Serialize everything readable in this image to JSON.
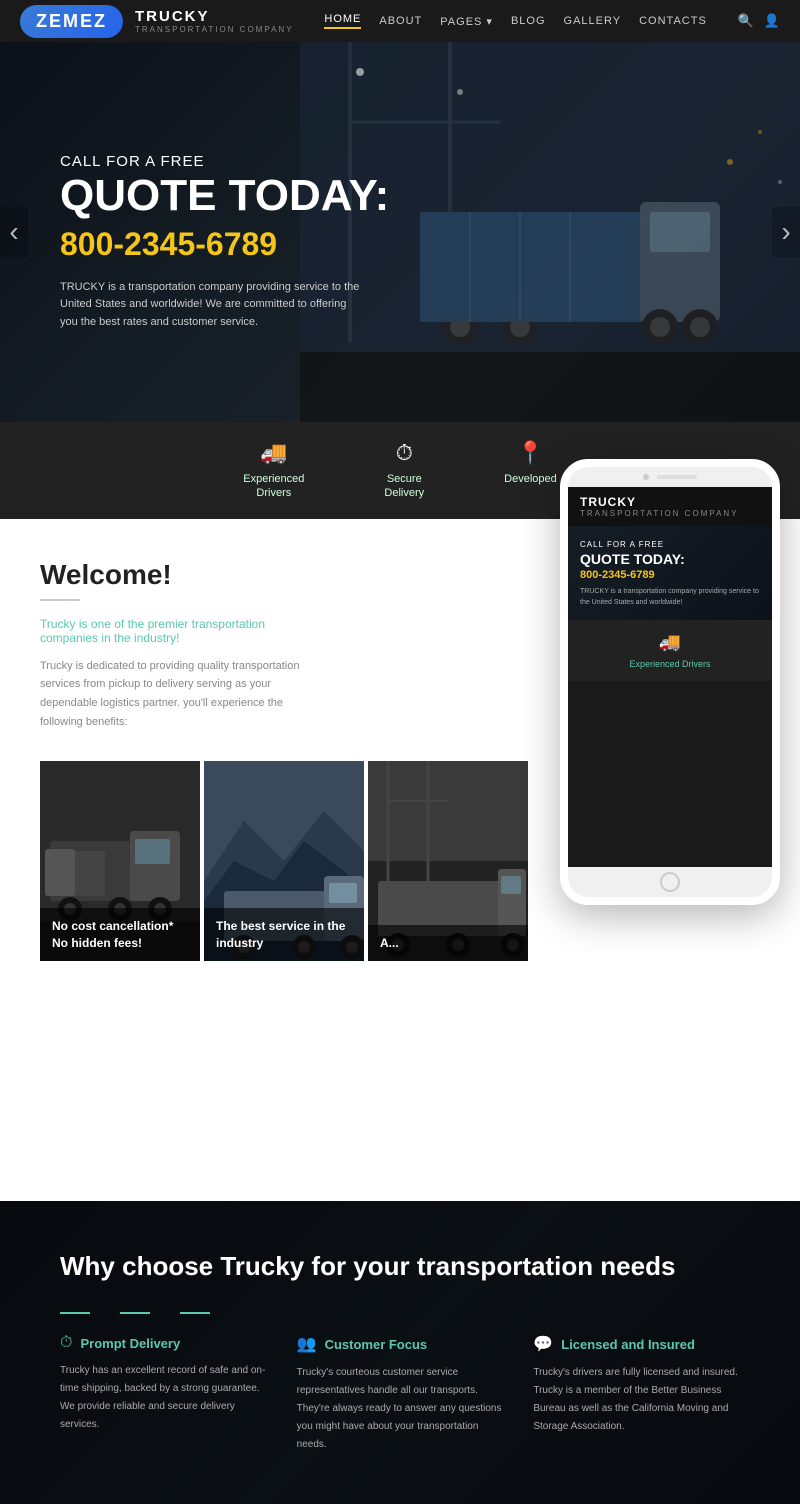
{
  "nav": {
    "brand": "TRUCKY",
    "brand_sub": "TRANSPORTATION COMPANY",
    "links": [
      "HOME",
      "ABOUT",
      "PAGES",
      "BLOG",
      "GALLERY",
      "CONTACTS"
    ],
    "active": "HOME"
  },
  "hero": {
    "call_label": "CALL FOR A FREE",
    "quote_label": "QUOTE TODAY:",
    "phone": "800-2345-6789",
    "description": "TRUCKY is a transportation company providing service to the United States and worldwide! We are committed to offering you the best rates and customer service."
  },
  "features": [
    {
      "icon": "🚚",
      "label": "Experienced\nDrivers"
    },
    {
      "icon": "⏱",
      "label": "Secure\nDelivery"
    },
    {
      "icon": "📍",
      "label": "Developed"
    }
  ],
  "welcome": {
    "title": "Welcome!",
    "subtitle": "Trucky is one of the premier transportation companies in the industry!",
    "description": "Trucky is dedicated to providing quality transportation services from pickup to delivery serving as your dependable logistics partner. you'll experience the following benefits:"
  },
  "gallery": [
    {
      "label": "No cost cancellation*\nNo hidden fees!"
    },
    {
      "label": "The best service in the industry"
    },
    {
      "label": "A..."
    }
  ],
  "phone_mockup": {
    "brand": "TRUCKY",
    "brand_sub": "TRANSPORTATION COMPANY",
    "call_label": "CALL FOR A FREE",
    "quote_label": "QUOTE TODAY:",
    "phone": "800-2345-6789",
    "description": "TRUCKY is a transportation company providing service to the United States and worldwide!",
    "feature_label": "Experienced Drivers"
  },
  "why": {
    "title": "Why choose Trucky for your transportation needs",
    "items": [
      {
        "icon": "⏱",
        "title": "Prompt Delivery",
        "description": "Trucky has an excellent record of safe and on-time shipping, backed by a strong guarantee. We provide reliable and secure delivery services."
      },
      {
        "icon": "👥",
        "title": "Customer Focus",
        "description": "Trucky's courteous customer service representatives handle all our transports. They're always ready to answer any questions you might have about your transportation needs."
      },
      {
        "icon": "💬",
        "title": "Licensed and Insured",
        "description": "Trucky's drivers are fully licensed and insured. Trucky is a member of the Better Business Bureau as well as the California Moving and Storage Association."
      }
    ]
  },
  "logo": {
    "text": "ZEMEZ"
  }
}
